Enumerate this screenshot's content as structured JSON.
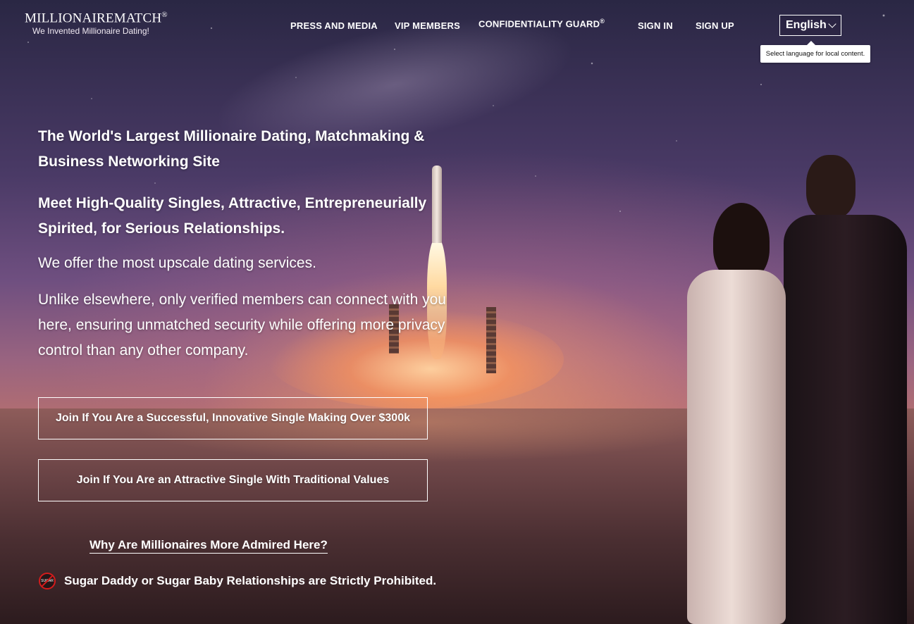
{
  "logo": {
    "title": "MILLIONAIREMATCH",
    "registered": "®",
    "tagline": "We Invented Millionaire Dating!"
  },
  "nav": {
    "press": "PRESS AND MEDIA",
    "vip": "VIP MEMBERS",
    "confidentiality": "CONFIDENTIALITY GUARD",
    "confidentiality_mark": "®",
    "sign_in": "SIGN IN",
    "sign_up": "SIGN UP"
  },
  "language": {
    "selected": "English",
    "icon": "chevron-down-icon",
    "tooltip": "Select language for local content."
  },
  "hero": {
    "headline": "The World's Largest Millionaire Dating, Matchmaking & Business Networking Site",
    "subheadline": "Meet High-Quality Singles, Attractive, Entrepreneurially Spirited, for Serious Relationships.",
    "offer": "We offer the most upscale dating services.",
    "verified": "Unlike elsewhere, only verified members can connect with you here, ensuring unmatched security while offering more privacy control than any other company."
  },
  "cta": {
    "successful": "Join If You Are a Successful, Innovative Single Making Over $300k",
    "attractive": "Join If You Are an Attractive Single With Traditional Values"
  },
  "links": {
    "why": "Why Are Millionaires More Admired Here?"
  },
  "notice": {
    "icon": "no-sugar-icon",
    "icon_text": "SUGAR",
    "text": "Sugar Daddy or Sugar Baby Relationships are Strictly Prohibited."
  },
  "colors": {
    "text": "#ffffff",
    "prohibited": "#d41c1c"
  }
}
